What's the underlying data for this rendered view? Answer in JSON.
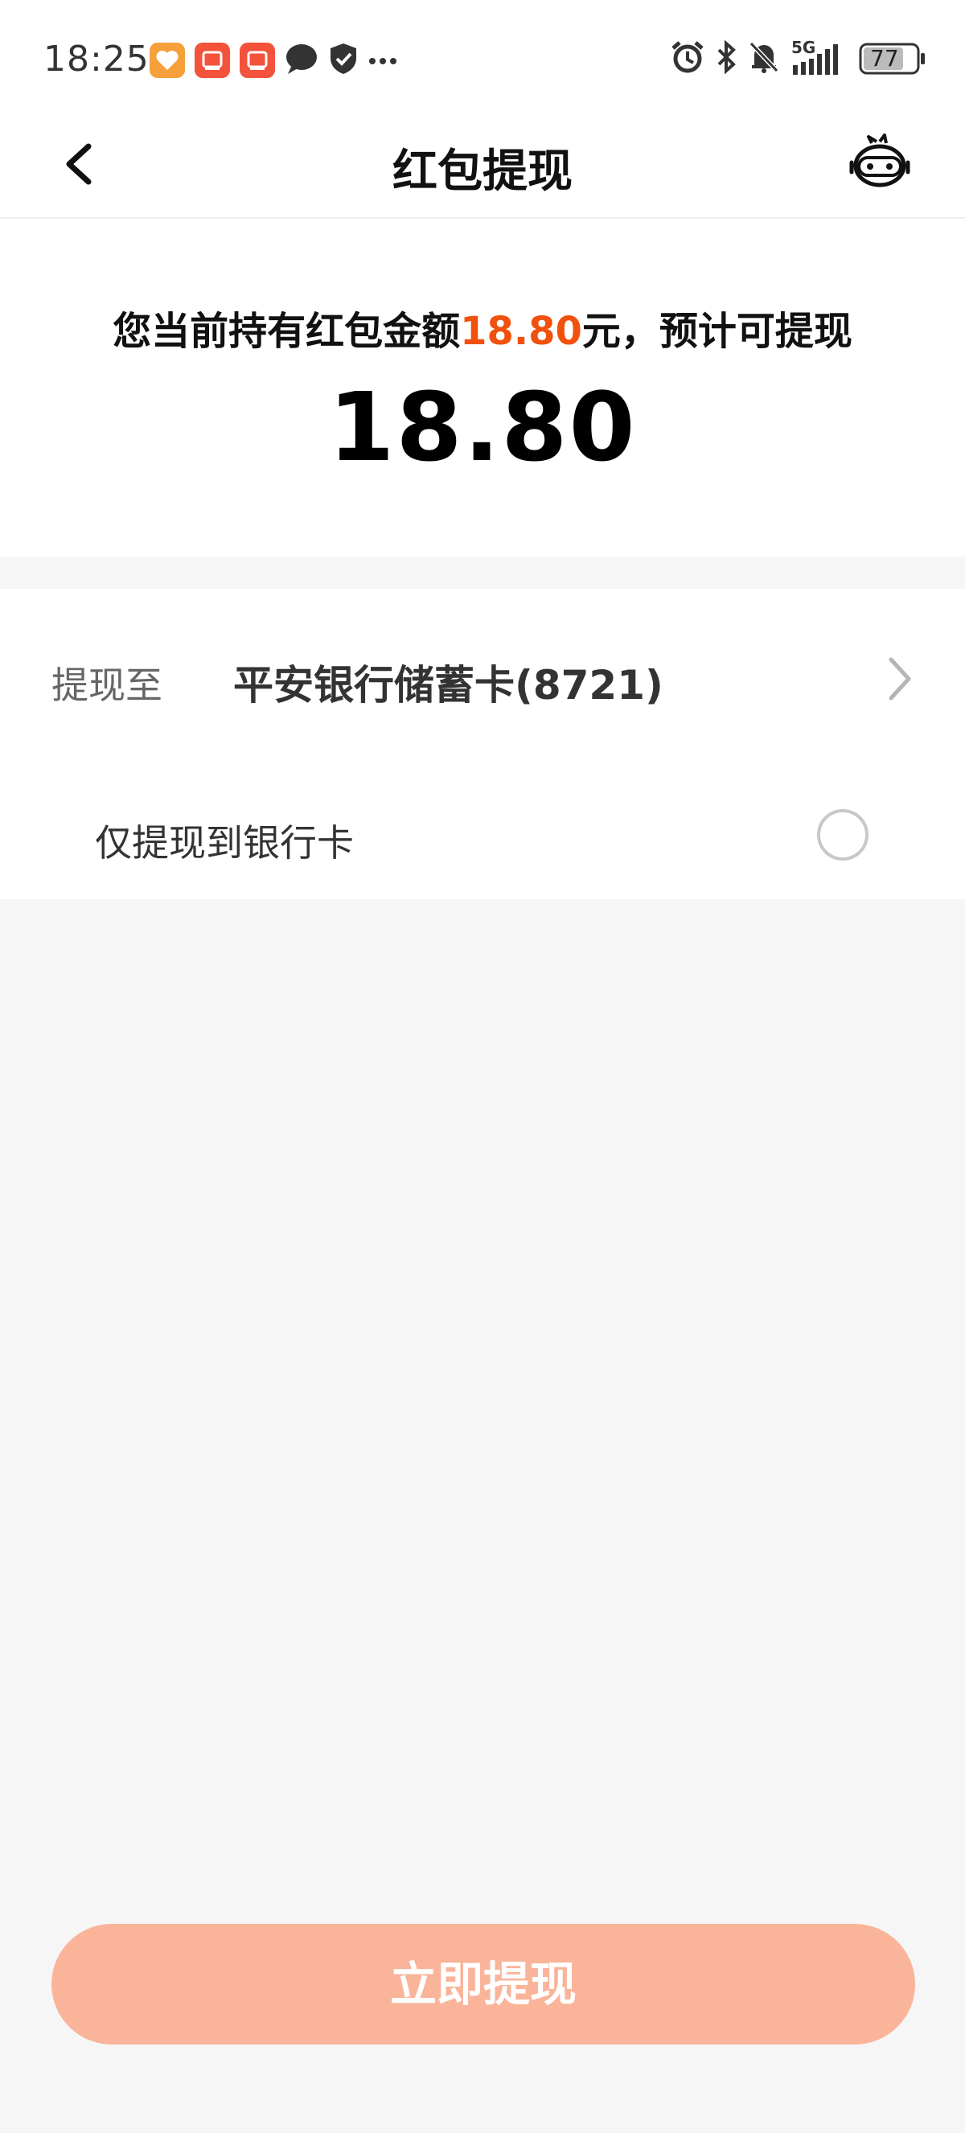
{
  "status_bar": {
    "time": "18:25",
    "battery": "77",
    "network": "5G",
    "icons": [
      "heart-app-icon",
      "shop-app-icon",
      "shop-app-icon-2",
      "chat-bubble-icon",
      "shield-check-icon",
      "more-dots-icon",
      "alarm-icon",
      "bluetooth-icon",
      "mute-bell-icon",
      "signal-icon",
      "battery-icon"
    ]
  },
  "nav": {
    "title": "红包提现",
    "back_icon": "chevron-left-icon",
    "service_icon": "customer-service-icon"
  },
  "amount": {
    "desc_prefix": "您当前持有红包金额",
    "desc_amount": "18.80",
    "desc_suffix": "元，预计可提现",
    "withdrawable": "18.80",
    "highlight_color": "#f0510d"
  },
  "withdraw": {
    "label": "提现至",
    "bank": "平安银行储蓄卡(8721)",
    "option_label": "仅提现到银行卡",
    "option_checked": false
  },
  "button": {
    "label": "立即提现",
    "color": "#f9b49a"
  }
}
